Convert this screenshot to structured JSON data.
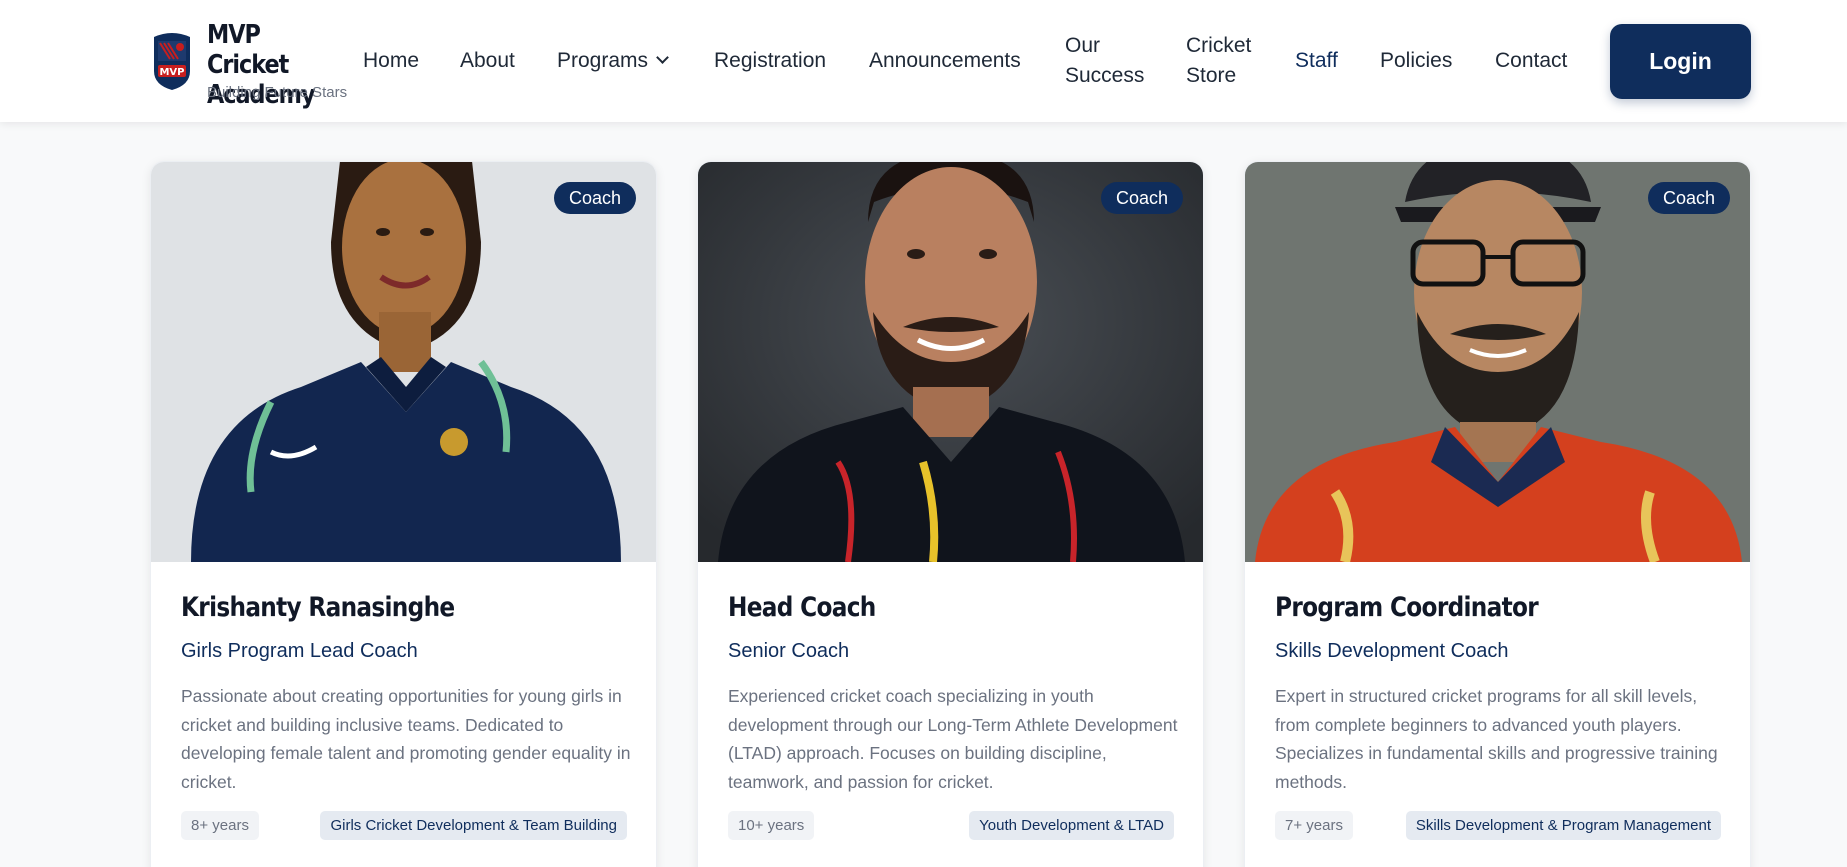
{
  "header": {
    "brand": {
      "title": "MVP Cricket Academy",
      "tagline": "Building Future Stars",
      "logo_text": "MVP"
    },
    "nav": [
      {
        "label": "Home"
      },
      {
        "label": "About"
      },
      {
        "label": "Programs"
      },
      {
        "label": "Registration"
      },
      {
        "label": "Announcements"
      },
      {
        "label": "Our Success"
      },
      {
        "label": "Cricket Store"
      },
      {
        "label": "Staff"
      },
      {
        "label": "Policies"
      },
      {
        "label": "Contact"
      }
    ],
    "login_label": "Login",
    "active_nav": "Staff"
  },
  "staff": [
    {
      "badge": "Coach",
      "name": "Krishanty Ranasinghe",
      "title": "Girls Program Lead Coach",
      "description": "Passionate about creating opportunities for young girls in cricket and building inclusive teams. Dedicated to developing female talent and promoting gender equality in cricket.",
      "experience": "8+ years",
      "specialty": "Girls Cricket Development & Team Building"
    },
    {
      "badge": "Coach",
      "name": "Head Coach",
      "title": "Senior Coach",
      "description": "Experienced cricket coach specializing in youth development through our Long-Term Athlete Development (LTAD) approach. Focuses on building discipline, teamwork, and passion for cricket.",
      "experience": "10+ years",
      "specialty": "Youth Development & LTAD"
    },
    {
      "badge": "Coach",
      "name": "Program Coordinator",
      "title": "Skills Development Coach",
      "description": "Expert in structured cricket programs for all skill levels, from complete beginners to advanced youth players. Specializes in fundamental skills and progressive training methods.",
      "experience": "7+ years",
      "specialty": "Skills Development & Program Management"
    }
  ],
  "colors": {
    "primary": "#0f2d5c",
    "background": "#f8f9fa"
  }
}
